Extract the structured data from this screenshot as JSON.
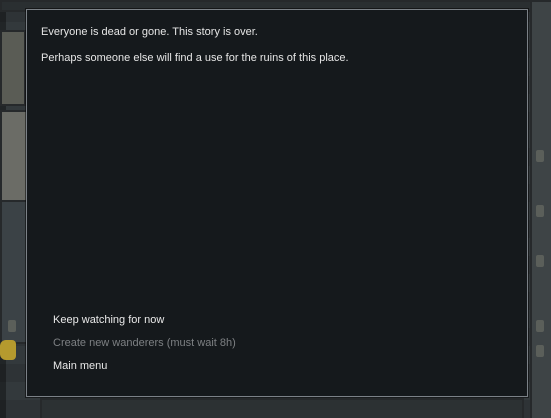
{
  "dialog": {
    "messages": [
      "Everyone is dead or gone. This story is over.",
      "Perhaps someone else will find a use for the ruins of this place."
    ],
    "options": [
      {
        "label": "Keep watching for now",
        "enabled": true
      },
      {
        "label": "Create new wanderers (must wait 8h)",
        "enabled": false
      },
      {
        "label": "Main menu",
        "enabled": true
      }
    ]
  },
  "colors": {
    "dialog_bg": "#15191c",
    "dialog_border": "#7b8187",
    "text": "#e6e6e6",
    "disabled_text": "#7d8083"
  }
}
